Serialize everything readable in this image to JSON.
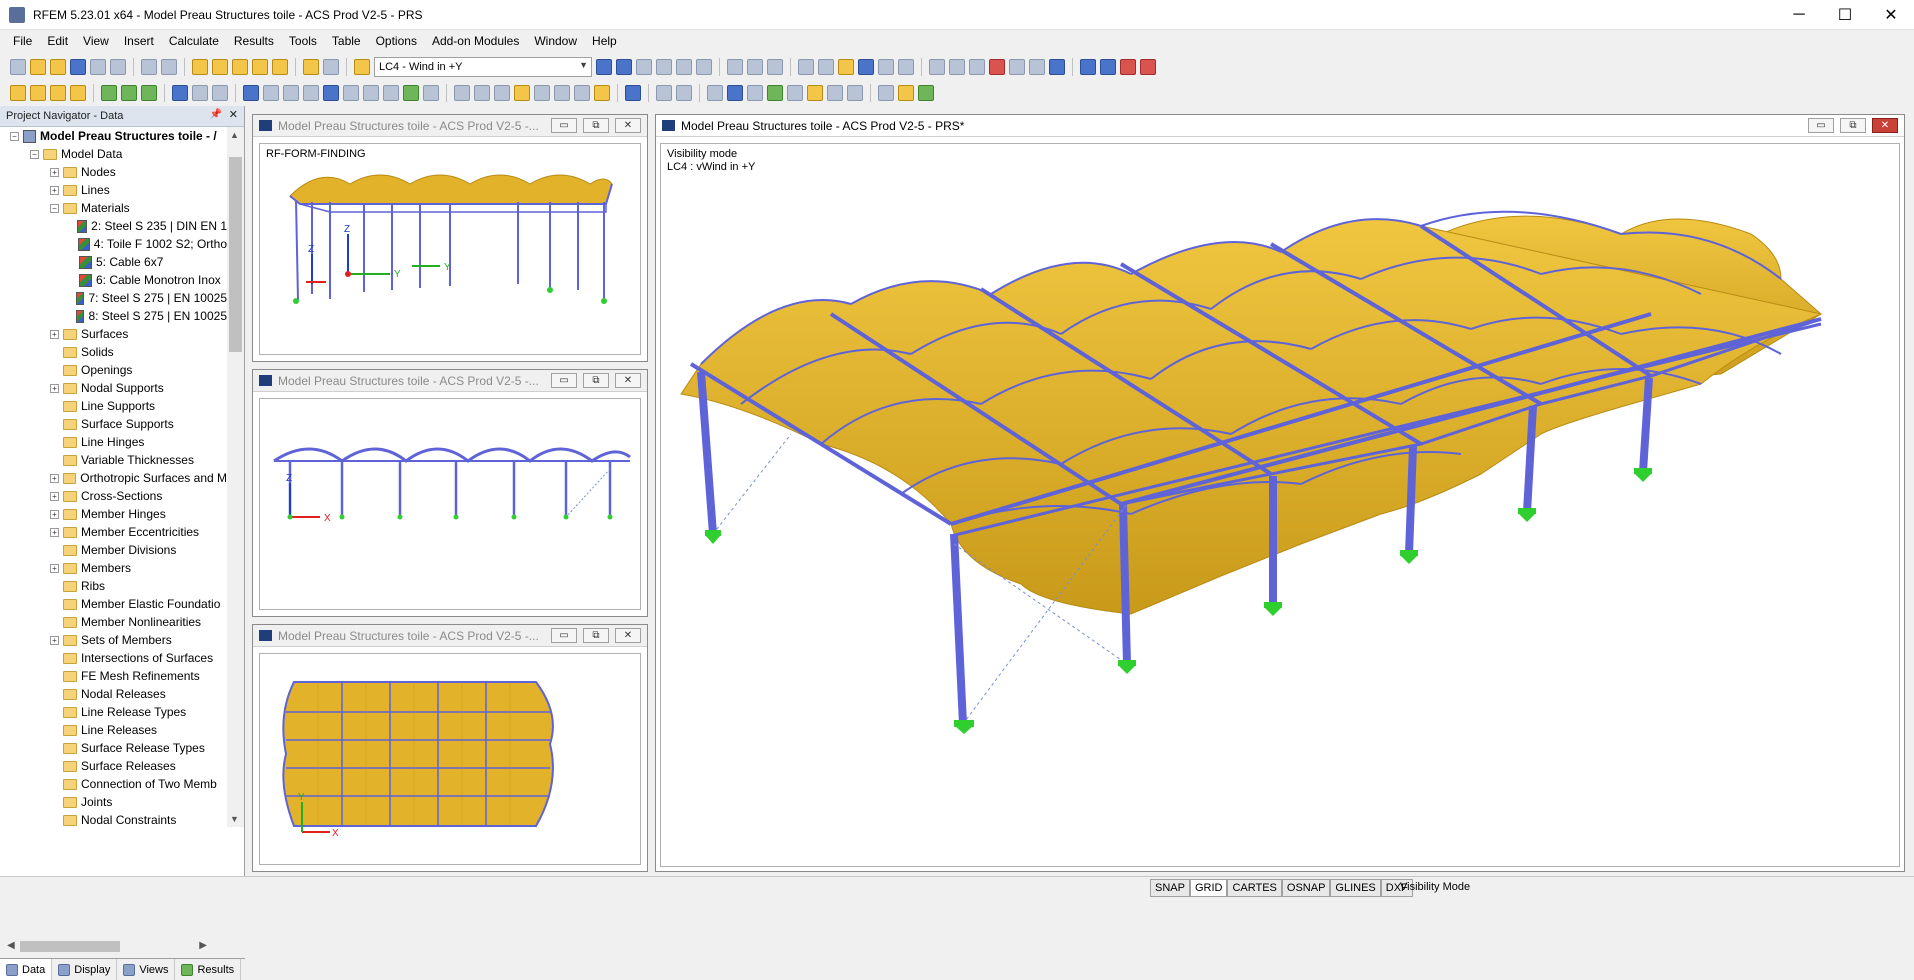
{
  "window": {
    "title": "RFEM 5.23.01 x64 - Model Preau Structures toile -  ACS Prod V2-5 - PRS",
    "minimize": "─",
    "maximize": "☐",
    "close": "✕"
  },
  "menu": [
    "File",
    "Edit",
    "View",
    "Insert",
    "Calculate",
    "Results",
    "Tools",
    "Table",
    "Options",
    "Add-on Modules",
    "Window",
    "Help"
  ],
  "toolbar": {
    "load_case": "LC4 - Wind in +Y",
    "combo_arrow": "▼"
  },
  "navigator": {
    "header": "Project Navigator - Data",
    "pin": "📌",
    "close": "✕",
    "root": "Model Preau Structures toile - /",
    "model_data": "Model Data",
    "items": [
      {
        "label": "Nodes",
        "exp": "+",
        "indent": 2,
        "icon": "folder"
      },
      {
        "label": "Lines",
        "exp": "+",
        "indent": 2,
        "icon": "folder"
      },
      {
        "label": "Materials",
        "exp": "−",
        "indent": 2,
        "icon": "folder"
      },
      {
        "label": "2: Steel S 235 | DIN EN 1",
        "exp": "",
        "indent": 3,
        "icon": "material"
      },
      {
        "label": "4: Toile F 1002 S2; Ortho",
        "exp": "",
        "indent": 3,
        "icon": "material"
      },
      {
        "label": "5: Cable 6x7",
        "exp": "",
        "indent": 3,
        "icon": "material"
      },
      {
        "label": "6: Cable Monotron Inox",
        "exp": "",
        "indent": 3,
        "icon": "material"
      },
      {
        "label": "7: Steel S 275 | EN 10025",
        "exp": "",
        "indent": 3,
        "icon": "material"
      },
      {
        "label": "8: Steel S 275 | EN 10025",
        "exp": "",
        "indent": 3,
        "icon": "material"
      },
      {
        "label": "Surfaces",
        "exp": "+",
        "indent": 2,
        "icon": "folder"
      },
      {
        "label": "Solids",
        "exp": "",
        "indent": 2,
        "icon": "folder"
      },
      {
        "label": "Openings",
        "exp": "",
        "indent": 2,
        "icon": "folder"
      },
      {
        "label": "Nodal Supports",
        "exp": "+",
        "indent": 2,
        "icon": "folder"
      },
      {
        "label": "Line Supports",
        "exp": "",
        "indent": 2,
        "icon": "folder"
      },
      {
        "label": "Surface Supports",
        "exp": "",
        "indent": 2,
        "icon": "folder"
      },
      {
        "label": "Line Hinges",
        "exp": "",
        "indent": 2,
        "icon": "folder"
      },
      {
        "label": "Variable Thicknesses",
        "exp": "",
        "indent": 2,
        "icon": "folder"
      },
      {
        "label": "Orthotropic Surfaces and M",
        "exp": "+",
        "indent": 2,
        "icon": "folder"
      },
      {
        "label": "Cross-Sections",
        "exp": "+",
        "indent": 2,
        "icon": "folder"
      },
      {
        "label": "Member Hinges",
        "exp": "+",
        "indent": 2,
        "icon": "folder"
      },
      {
        "label": "Member Eccentricities",
        "exp": "+",
        "indent": 2,
        "icon": "folder"
      },
      {
        "label": "Member Divisions",
        "exp": "",
        "indent": 2,
        "icon": "folder"
      },
      {
        "label": "Members",
        "exp": "+",
        "indent": 2,
        "icon": "folder"
      },
      {
        "label": "Ribs",
        "exp": "",
        "indent": 2,
        "icon": "folder"
      },
      {
        "label": "Member Elastic Foundatio",
        "exp": "",
        "indent": 2,
        "icon": "folder"
      },
      {
        "label": "Member Nonlinearities",
        "exp": "",
        "indent": 2,
        "icon": "folder"
      },
      {
        "label": "Sets of Members",
        "exp": "+",
        "indent": 2,
        "icon": "folder"
      },
      {
        "label": "Intersections of Surfaces",
        "exp": "",
        "indent": 2,
        "icon": "folder"
      },
      {
        "label": "FE Mesh Refinements",
        "exp": "",
        "indent": 2,
        "icon": "folder"
      },
      {
        "label": "Nodal Releases",
        "exp": "",
        "indent": 2,
        "icon": "folder"
      },
      {
        "label": "Line Release Types",
        "exp": "",
        "indent": 2,
        "icon": "folder"
      },
      {
        "label": "Line Releases",
        "exp": "",
        "indent": 2,
        "icon": "folder"
      },
      {
        "label": "Surface Release Types",
        "exp": "",
        "indent": 2,
        "icon": "folder"
      },
      {
        "label": "Surface Releases",
        "exp": "",
        "indent": 2,
        "icon": "folder"
      },
      {
        "label": "Connection of Two Memb",
        "exp": "",
        "indent": 2,
        "icon": "folder"
      },
      {
        "label": "Joints",
        "exp": "",
        "indent": 2,
        "icon": "folder"
      },
      {
        "label": "Nodal Constraints",
        "exp": "",
        "indent": 2,
        "icon": "folder"
      }
    ],
    "tabs": [
      "Data",
      "Display",
      "Views",
      "Results"
    ]
  },
  "subwindows": {
    "small_title": "Model Preau Structures toile -  ACS Prod V2-5 -...",
    "top_label": "RF-FORM-FINDING",
    "main_title": "Model Preau Structures toile -  ACS Prod V2-5 - PRS*",
    "main_line1": "Visibility mode",
    "main_line2": "LC4 : vWind in +Y",
    "min": "▭",
    "max": "⧉",
    "close": "✕"
  },
  "axes": {
    "x": "X",
    "y": "Y",
    "z": "Z"
  },
  "status": {
    "buttons": [
      "SNAP",
      "GRID",
      "CARTES",
      "OSNAP",
      "GLINES",
      "DXF"
    ],
    "active": [
      "GRID"
    ],
    "mode": "Visibility Mode"
  },
  "colors": {
    "membrane": "#e2b32a",
    "membrane_dark": "#b98a12",
    "steel": "#5f63d8",
    "support": "#2ecf2e",
    "axis_x": "#e0201a",
    "axis_y": "#22b022",
    "axis_z": "#1a3fd0"
  }
}
